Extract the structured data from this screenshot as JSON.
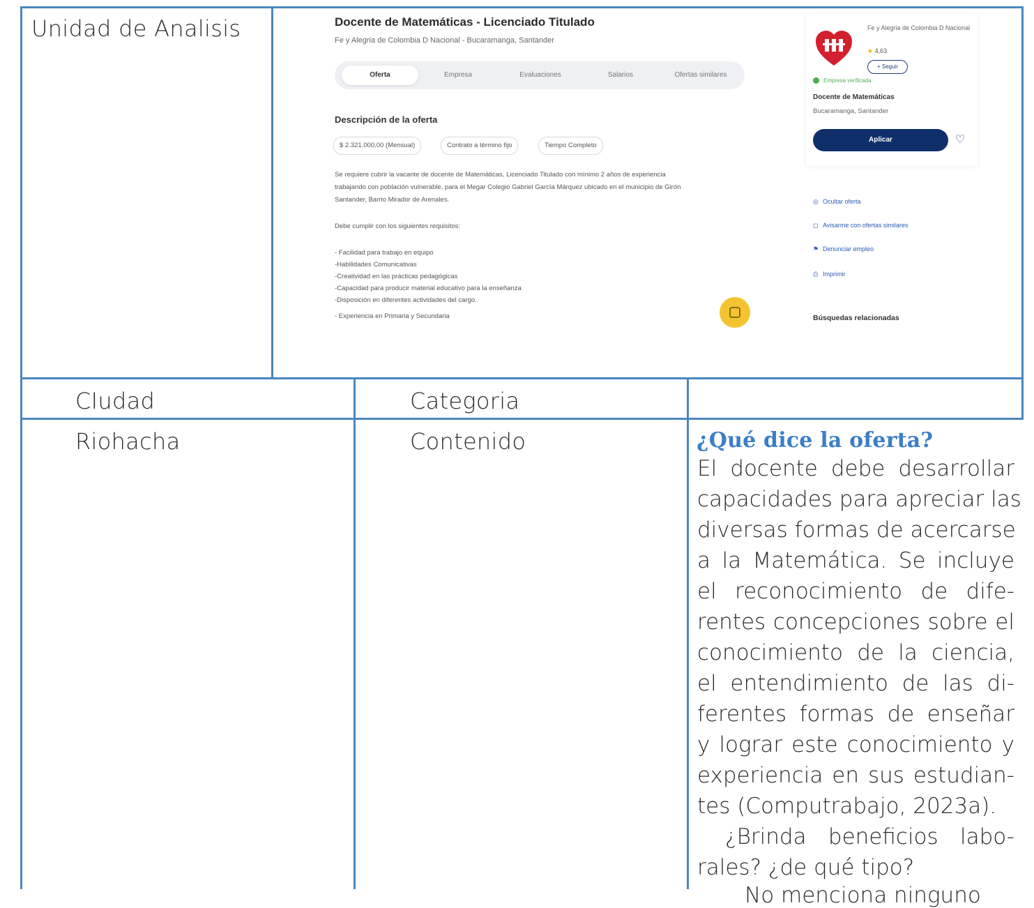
{
  "table": {
    "unidad_label": "Unidad de Analisis",
    "ciudad_header": "CIudad",
    "categoria_header": "Categoria",
    "ciudad_value": "Riohacha",
    "categoria_value": "Contenido",
    "analysis_title": "¿Qué dice la oferta?",
    "analysis_lines": [
      "El docente debe desarrollar",
      "capacidades para apreciar las",
      "diversas formas de acercarse",
      "a la Matemática. Se incluye",
      "el reconocimiento de dife-",
      "rentes concepciones sobre el",
      "conocimiento de la ciencia,",
      "el entendimiento de las di-",
      "ferentes formas de enseñar",
      "y lograr este conocimiento y",
      "experiencia en sus estudian-",
      "tes (Computrabajo, 2023a).",
      "¿Brinda beneficios labo-",
      "rales? ¿de qué tipo?",
      "No menciona ninguno"
    ]
  },
  "screenshot": {
    "job_title": "Docente de Matemáticas - Licenciado Titulado",
    "job_subtitle": "Fe y Alegria de Colombia D Nacional - Bucaramanga, Santander",
    "tabs": [
      "Oferta",
      "Empresa",
      "Evaluaciones",
      "Salarios",
      "Ofertas similares"
    ],
    "description_heading": "Descripción de la oferta",
    "chips": [
      "$ 2.321.000,00 (Mensual)",
      "Contrato a término fijo",
      "Tiempo Completo"
    ],
    "paragraphs": [
      "Se requiere cubrir la vacante de docente de Matemáticas, Licenciado Titulado con mínimo 2 años de experiencia",
      "trabajando con población vulnerable, para el Megar Colegio Gabriel García Márquez ubicado en el municipio de Girón",
      "Santander, Barrio Mirador de Arenales.",
      "Debe cumplir con los siguientes requisitos:",
      "- Facilidad para trabajo en equipo",
      "-Habilidades Comunicativas",
      "-Creatividad en las prácticas pedagógicas",
      "-Capacidad para producir material educativo para la enseñanza",
      "-Disposición en diferentes actividades del cargo.",
      "- Experiencia en Primaria y Secundaria"
    ],
    "company_name": "Fe y Alegria de Colombia D Nacional",
    "rating": "4,63",
    "follow_label": "+ Seguir",
    "verified_label": "Empresa verificada",
    "card_job": "Docente de Matemáticas",
    "card_location": "Bucaramanga, Santander",
    "apply_label": "Aplicar",
    "actions": [
      "Ocultar oferta",
      "Avisarme con ofertas similares",
      "Denunciar empleo",
      "Imprimir"
    ],
    "related_heading": "Búsquedas relacionadas",
    "colors": {
      "apply": "#0f2f6b",
      "logo_red": "#d3202e",
      "verified": "#4caf50",
      "fab": "#f4c430"
    }
  },
  "colors": {
    "table_border": "#4a86c0",
    "section_title": "#3b7ec8"
  }
}
